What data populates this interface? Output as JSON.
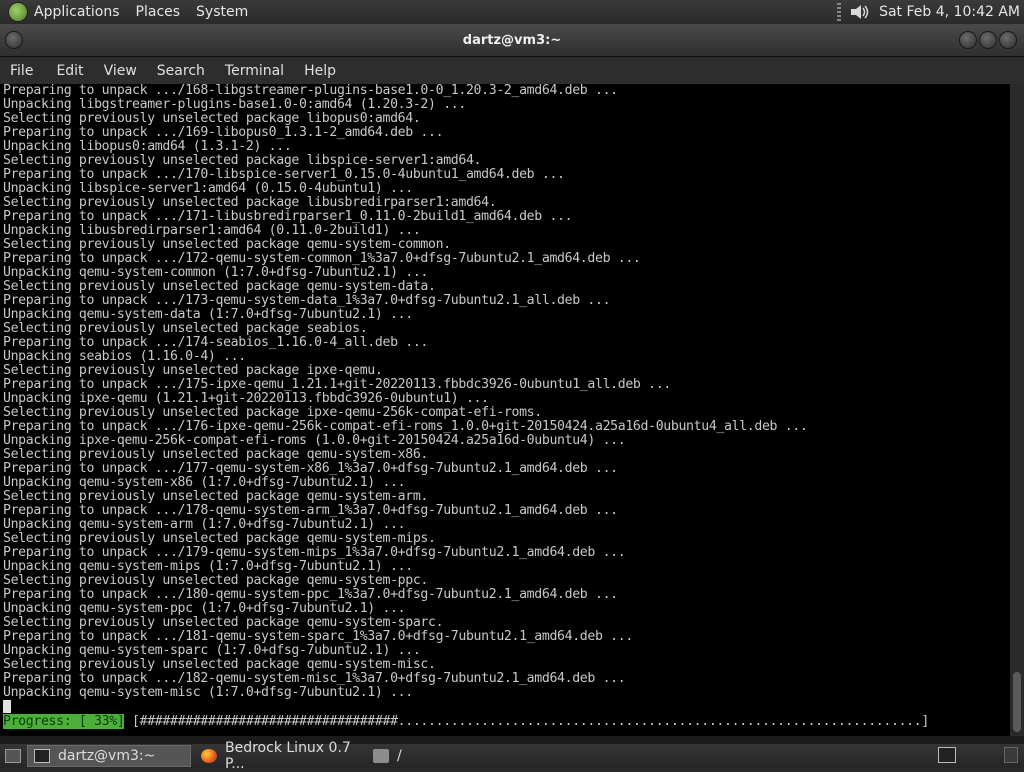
{
  "top_panel": {
    "menus": [
      "Applications",
      "Places",
      "System"
    ],
    "clock": "Sat Feb  4, 10:42 AM"
  },
  "window": {
    "title": "dartz@vm3:~",
    "menu": [
      "File",
      "Edit",
      "View",
      "Search",
      "Terminal",
      "Help"
    ]
  },
  "terminal": {
    "lines": [
      "Preparing to unpack .../168-libgstreamer-plugins-base1.0-0_1.20.3-2_amd64.deb ...",
      "Unpacking libgstreamer-plugins-base1.0-0:amd64 (1.20.3-2) ...",
      "Selecting previously unselected package libopus0:amd64.",
      "Preparing to unpack .../169-libopus0_1.3.1-2_amd64.deb ...",
      "Unpacking libopus0:amd64 (1.3.1-2) ...",
      "Selecting previously unselected package libspice-server1:amd64.",
      "Preparing to unpack .../170-libspice-server1_0.15.0-4ubuntu1_amd64.deb ...",
      "Unpacking libspice-server1:amd64 (0.15.0-4ubuntu1) ...",
      "Selecting previously unselected package libusbredirparser1:amd64.",
      "Preparing to unpack .../171-libusbredirparser1_0.11.0-2build1_amd64.deb ...",
      "Unpacking libusbredirparser1:amd64 (0.11.0-2build1) ...",
      "Selecting previously unselected package qemu-system-common.",
      "Preparing to unpack .../172-qemu-system-common_1%3a7.0+dfsg-7ubuntu2.1_amd64.deb ...",
      "Unpacking qemu-system-common (1:7.0+dfsg-7ubuntu2.1) ...",
      "Selecting previously unselected package qemu-system-data.",
      "Preparing to unpack .../173-qemu-system-data_1%3a7.0+dfsg-7ubuntu2.1_all.deb ...",
      "Unpacking qemu-system-data (1:7.0+dfsg-7ubuntu2.1) ...",
      "Selecting previously unselected package seabios.",
      "Preparing to unpack .../174-seabios_1.16.0-4_all.deb ...",
      "Unpacking seabios (1.16.0-4) ...",
      "Selecting previously unselected package ipxe-qemu.",
      "Preparing to unpack .../175-ipxe-qemu_1.21.1+git-20220113.fbbdc3926-0ubuntu1_all.deb ...",
      "Unpacking ipxe-qemu (1.21.1+git-20220113.fbbdc3926-0ubuntu1) ...",
      "Selecting previously unselected package ipxe-qemu-256k-compat-efi-roms.",
      "Preparing to unpack .../176-ipxe-qemu-256k-compat-efi-roms_1.0.0+git-20150424.a25a16d-0ubuntu4_all.deb ...",
      "Unpacking ipxe-qemu-256k-compat-efi-roms (1.0.0+git-20150424.a25a16d-0ubuntu4) ...",
      "Selecting previously unselected package qemu-system-x86.",
      "Preparing to unpack .../177-qemu-system-x86_1%3a7.0+dfsg-7ubuntu2.1_amd64.deb ...",
      "Unpacking qemu-system-x86 (1:7.0+dfsg-7ubuntu2.1) ...",
      "Selecting previously unselected package qemu-system-arm.",
      "Preparing to unpack .../178-qemu-system-arm_1%3a7.0+dfsg-7ubuntu2.1_amd64.deb ...",
      "Unpacking qemu-system-arm (1:7.0+dfsg-7ubuntu2.1) ...",
      "Selecting previously unselected package qemu-system-mips.",
      "Preparing to unpack .../179-qemu-system-mips_1%3a7.0+dfsg-7ubuntu2.1_amd64.deb ...",
      "Unpacking qemu-system-mips (1:7.0+dfsg-7ubuntu2.1) ...",
      "Selecting previously unselected package qemu-system-ppc.",
      "Preparing to unpack .../180-qemu-system-ppc_1%3a7.0+dfsg-7ubuntu2.1_amd64.deb ...",
      "Unpacking qemu-system-ppc (1:7.0+dfsg-7ubuntu2.1) ...",
      "Selecting previously unselected package qemu-system-sparc.",
      "Preparing to unpack .../181-qemu-system-sparc_1%3a7.0+dfsg-7ubuntu2.1_amd64.deb ...",
      "Unpacking qemu-system-sparc (1:7.0+dfsg-7ubuntu2.1) ...",
      "Selecting previously unselected package qemu-system-misc.",
      "Preparing to unpack .../182-qemu-system-misc_1%3a7.0+dfsg-7ubuntu2.1_amd64.deb ...",
      "Unpacking qemu-system-misc (1:7.0+dfsg-7ubuntu2.1) ..."
    ],
    "progress_label": "Progress: [ 33%]",
    "progress_bar": " [##################################.....................................................................]",
    "progress_value": 0.33
  },
  "taskbar": {
    "tasks": [
      {
        "label": "dartz@vm3:~",
        "active": true
      },
      {
        "label": "Bedrock Linux 0.7 P...",
        "active": false
      },
      {
        "label": "/",
        "active": false
      }
    ]
  }
}
